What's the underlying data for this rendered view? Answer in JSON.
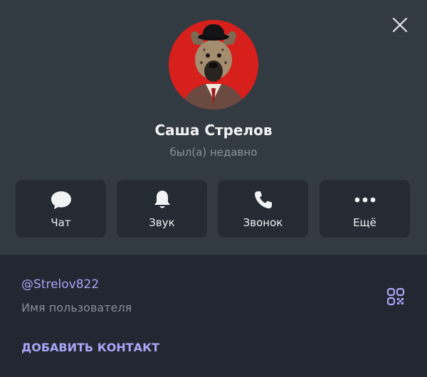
{
  "profile": {
    "name": "Саша Стрелов",
    "status": "был(а) недавно"
  },
  "actions": [
    {
      "label": "Чат",
      "icon": "chat-bubble-icon"
    },
    {
      "label": "Звук",
      "icon": "bell-icon"
    },
    {
      "label": "Звонок",
      "icon": "phone-icon"
    },
    {
      "label": "Ещё",
      "icon": "more-dots-icon"
    }
  ],
  "info": {
    "username": "@Strelov822",
    "username_caption": "Имя пользователя"
  },
  "add_contact_label": "ДОБАВИТЬ КОНТАКТ",
  "icons": {
    "close": "close-icon",
    "qr": "qr-code-icon",
    "avatar": "avatar-hyena-icon"
  },
  "colors": {
    "panel_top": "#323a42",
    "panel_bottom": "#222831",
    "button_bg": "#252b33",
    "accent": "#a7a6f7",
    "avatar_bg": "#d71f1c"
  }
}
